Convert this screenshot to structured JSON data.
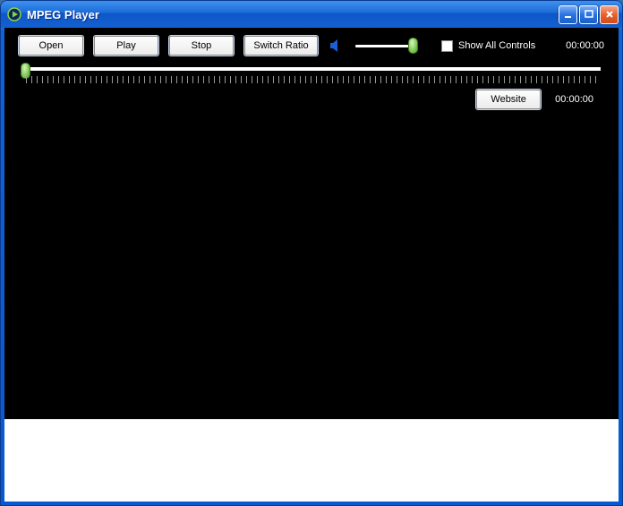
{
  "window": {
    "title": "MPEG Player"
  },
  "toolbar": {
    "open_label": "Open",
    "play_label": "Play",
    "stop_label": "Stop",
    "switch_ratio_label": "Switch Ratio",
    "show_all_controls_label": "Show All Controls",
    "show_all_controls_checked": false,
    "volume_percent": 100
  },
  "time": {
    "top": "00:00:00",
    "bottom": "00:00:00"
  },
  "seek": {
    "position_percent": 0
  },
  "links": {
    "website_label": "Website"
  }
}
